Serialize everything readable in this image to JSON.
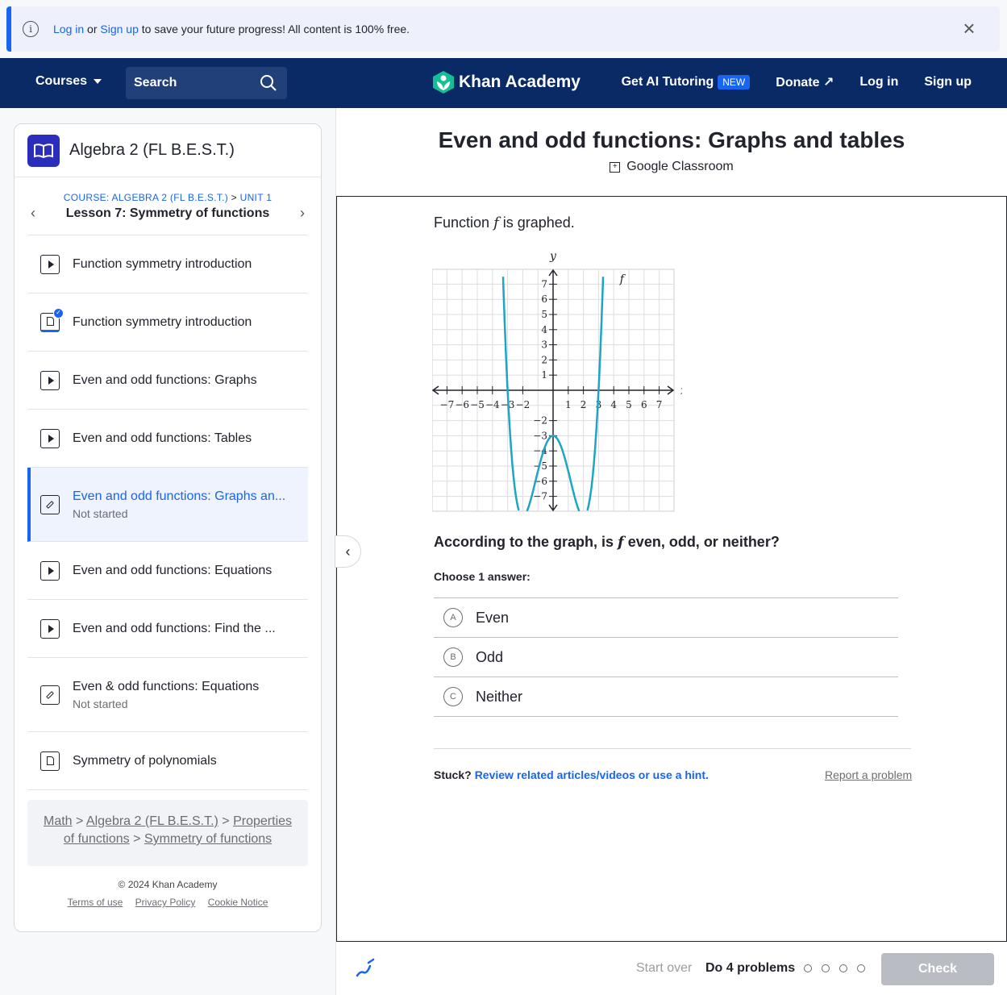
{
  "banner": {
    "login": "Log in",
    "or": "or",
    "signup": "Sign up",
    "message": "to save your future progress! All content is 100% free."
  },
  "nav": {
    "courses": "Courses",
    "search_label": "Search",
    "logo": "Khan Academy",
    "ai_tutoring": "Get AI Tutoring",
    "new_badge": "NEW",
    "donate": "Donate",
    "login": "Log in",
    "signup": "Sign up"
  },
  "sidebar": {
    "course_title": "Algebra 2 (FL B.E.S.T.)",
    "course_crumb": "COURSE: ALGEBRA 2 (FL B.E.S.T.)",
    "unit_crumb": "UNIT 1",
    "crumb_sep": ">",
    "lesson": "Lesson 7: Symmetry of functions",
    "items": [
      {
        "type": "video",
        "label": "Function symmetry introduction",
        "sub": ""
      },
      {
        "type": "article",
        "label": "Function symmetry introduction",
        "sub": ""
      },
      {
        "type": "video",
        "label": "Even and odd functions: Graphs",
        "sub": ""
      },
      {
        "type": "video",
        "label": "Even and odd functions: Tables",
        "sub": ""
      },
      {
        "type": "exercise",
        "label": "Even and odd functions: Graphs an...",
        "sub": "Not started"
      },
      {
        "type": "video",
        "label": "Even and odd functions: Equations",
        "sub": ""
      },
      {
        "type": "video",
        "label": "Even and odd functions: Find the ...",
        "sub": ""
      },
      {
        "type": "exercise",
        "label": "Even & odd functions: Equations",
        "sub": "Not started"
      },
      {
        "type": "article",
        "label": "Symmetry of polynomials",
        "sub": ""
      }
    ],
    "breadcrumbs": {
      "math": "Math",
      "course": "Algebra 2 (FL B.E.S.T.)",
      "unit_a": "Properties",
      "unit_b": "of functions",
      "lesson": "Symmetry of functions",
      "sep": ">"
    },
    "footer": {
      "copyright": "© 2024 Khan Academy",
      "terms": "Terms of use",
      "privacy": "Privacy Policy",
      "cookie": "Cookie Notice"
    }
  },
  "main": {
    "title": "Even and odd functions: Graphs and tables",
    "google_classroom": "Google Classroom",
    "intro_a": "Function",
    "intro_var": "f",
    "intro_b": "is graphed.",
    "question_a": "According to the graph, is",
    "question_var": "f",
    "question_b": "even, odd, or neither?",
    "choose": "Choose 1 answer:",
    "choices": [
      {
        "letter": "A",
        "label": "Even"
      },
      {
        "letter": "B",
        "label": "Odd"
      },
      {
        "letter": "C",
        "label": "Neither"
      }
    ],
    "stuck": "Stuck?",
    "stuck_link": "Review related articles/videos or use a hint.",
    "report": "Report a problem"
  },
  "graph": {
    "x_axis_label": "x",
    "y_axis_label": "y",
    "function_label": "f",
    "x_range": [
      -8,
      8
    ],
    "y_range": [
      -8,
      8
    ],
    "x_ticks": [
      -7,
      -6,
      -5,
      -4,
      -3,
      -2,
      1,
      2,
      3,
      4,
      5,
      6,
      7
    ],
    "y_ticks": [
      7,
      6,
      5,
      4,
      3,
      2,
      1,
      -2,
      -3,
      -4,
      -5,
      -6,
      -7
    ],
    "curve_color": "#1fa5c4",
    "key_points": [
      [
        -3,
        0
      ],
      [
        -2,
        -7
      ],
      [
        0,
        -3
      ],
      [
        2,
        -7
      ],
      [
        3,
        0
      ]
    ]
  },
  "bottom": {
    "start_over": "Start over",
    "do_problems": "Do 4 problems",
    "check": "Check"
  },
  "colors": {
    "brand_blue": "#1865f2",
    "nav_bg": "#0a2a66"
  }
}
